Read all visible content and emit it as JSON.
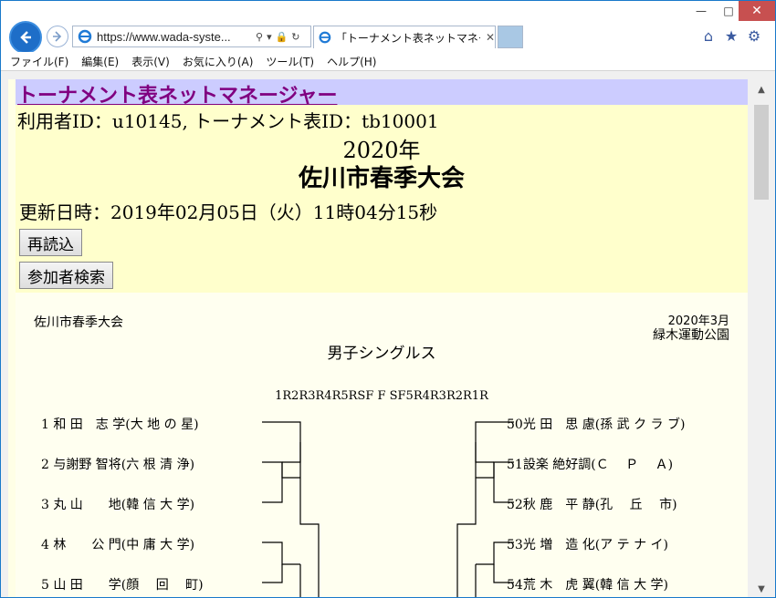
{
  "browser": {
    "address": "https://www.wada-syste...",
    "tab_title": "「トーナメント表ネットマネージャ...",
    "menu": [
      "ファイル(F)",
      "編集(E)",
      "表示(V)",
      "お気に入り(A)",
      "ツール(T)",
      "ヘルプ(H)"
    ]
  },
  "site": {
    "title": "トーナメント表ネットマネージャー",
    "user_line": "利用者ID：u10145, トーナメント表ID：tb10001",
    "year": "2020年",
    "event": "佐川市春季大会",
    "updated": "更新日時：2019年02月05日（火）11時04分15秒",
    "reload_label": "再読込",
    "search_label": "参加者検索"
  },
  "bracket": {
    "tournament": "佐川市春季大会",
    "date": "2020年3月",
    "venue": "緑木運動公園",
    "event": "男子シングルス",
    "rounds": "1R2R3R4R5RSF F SF5R4R3R2R1R",
    "left_players": [
      "1 和 田　志 学(大 地 の 星)",
      "2 与謝野 智将(六 根 清 浄)",
      "3 丸 山　　地(韓 信 大 学)",
      "4 林　　公 門(中 庸 大 学)",
      "5 山 田　　学(顔　 回　 町)"
    ],
    "right_players": [
      "50光 田　思 慮(孫 武 ク ラ ブ)",
      "51設楽 絶好調(Ｃ　 Ｐ　 Ａ)",
      "52秋 鹿　平 静(孔　 丘　 市)",
      "53光 増　造 化(ア テ ナ イ)",
      "54荒 木　虎 翼(韓 信 大 学)"
    ]
  }
}
